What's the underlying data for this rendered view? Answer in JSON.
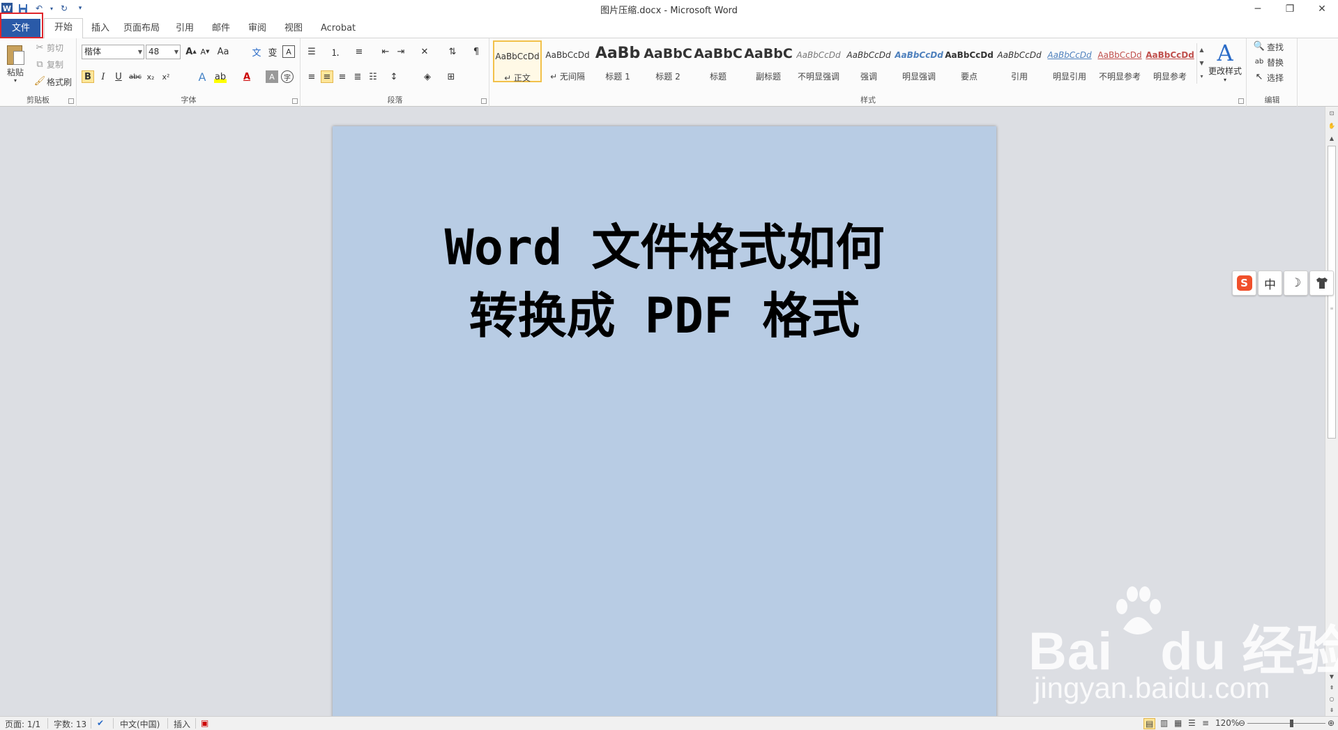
{
  "window": {
    "title": "图片压缩.docx - Microsoft Word",
    "controls": [
      "─",
      "❐",
      "✕"
    ]
  },
  "quick_access": {
    "icons": [
      "word-logo-icon",
      "save-icon",
      "undo-icon",
      "redo-icon",
      "customize-icon"
    ],
    "word_logo": "W"
  },
  "tabs": [
    {
      "label": "文件",
      "active": false,
      "highlighted": true
    },
    {
      "label": "开始",
      "active": true
    },
    {
      "label": "插入"
    },
    {
      "label": "页面布局"
    },
    {
      "label": "引用"
    },
    {
      "label": "邮件"
    },
    {
      "label": "审阅"
    },
    {
      "label": "视图"
    },
    {
      "label": "Acrobat"
    }
  ],
  "clipboard": {
    "paste": "粘贴",
    "cut": "剪切",
    "copy": "复制",
    "format_painter": "格式刷",
    "group": "剪贴板"
  },
  "font": {
    "family": "楷体",
    "size": "48",
    "group": "字体"
  },
  "paragraph": {
    "group": "段落"
  },
  "styles": {
    "group": "样式",
    "items": [
      {
        "sample": "AaBbCcDd",
        "name": "↵ 正文"
      },
      {
        "sample": "AaBbCcDd",
        "name": "↵ 无间隔"
      },
      {
        "sample": "AaBb",
        "name": "标题 1"
      },
      {
        "sample": "AaBbC",
        "name": "标题 2"
      },
      {
        "sample": "AaBbC",
        "name": "标题"
      },
      {
        "sample": "AaBbC",
        "name": "副标题"
      },
      {
        "sample": "AaBbCcDd",
        "name": "不明显强调"
      },
      {
        "sample": "AaBbCcDd",
        "name": "强调"
      },
      {
        "sample": "AaBbCcDd",
        "name": "明显强调"
      },
      {
        "sample": "AaBbCcDd",
        "name": "要点"
      },
      {
        "sample": "AaBbCcDd",
        "name": "引用"
      },
      {
        "sample": "AaBbCcDd",
        "name": "明显引用"
      },
      {
        "sample": "AaBbCcDd",
        "name": "不明显参考"
      },
      {
        "sample": "AaBbCcDd",
        "name": "明显参考"
      }
    ],
    "change_styles": "更改样式"
  },
  "editing": {
    "find": "查找",
    "replace": "替换",
    "select": "选择",
    "group": "编辑"
  },
  "document": {
    "line1": "Word 文件格式如何",
    "line2": "转换成 PDF 格式",
    "page_color": "#b8cce4"
  },
  "ime": {
    "logo": "S",
    "mode": "中",
    "moon": "☽",
    "shirt": "👕"
  },
  "watermark": {
    "brand_left": "Bai",
    "brand_right": "du 经验",
    "url": "jingyan.baidu.com"
  },
  "status": {
    "page": "页面: 1/1",
    "words": "字数: 13",
    "language": "中文(中国)",
    "mode": "插入",
    "zoom": "120%",
    "zoom_value": 120
  },
  "colors": {
    "file_tab": "#2a5aa8",
    "highlight_border": "#e0252b",
    "accent": "#2b579a"
  }
}
